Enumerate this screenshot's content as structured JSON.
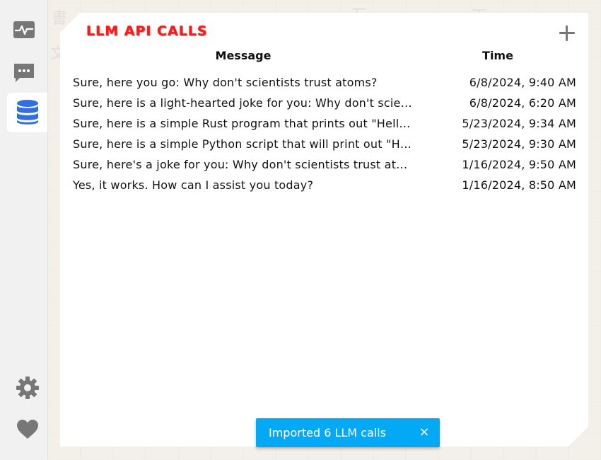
{
  "panel": {
    "title": "LLM API CALLS",
    "add_icon": "plus-icon"
  },
  "sidebar": {
    "items": [
      {
        "name": "activity",
        "icon": "pulse-icon",
        "active": false
      },
      {
        "name": "chat",
        "icon": "chat-bubble-icon",
        "active": false
      },
      {
        "name": "database",
        "icon": "database-icon",
        "active": true
      },
      {
        "name": "settings",
        "icon": "gear-icon",
        "active": false
      },
      {
        "name": "favorites",
        "icon": "heart-icon",
        "active": false
      }
    ]
  },
  "table": {
    "headers": {
      "message": "Message",
      "time": "Time"
    },
    "rows": [
      {
        "message": "Sure, here you go: Why don't scientists trust atoms?",
        "time": "6/8/2024, 9:40 AM"
      },
      {
        "message": "Sure, here is a light-hearted joke for you: Why don't scientists trust atoms?",
        "time": "6/8/2024, 6:20 AM"
      },
      {
        "message": "Sure, here is a simple Rust program that prints out \"Hello, world!\"",
        "time": "5/23/2024, 9:34 AM"
      },
      {
        "message": "Sure, here is a simple Python script that will print out \"Hello, world!\"",
        "time": "5/23/2024, 9:30 AM"
      },
      {
        "message": "Sure, here's a joke for you: Why don't scientists trust atoms?",
        "time": "1/16/2024, 9:50 AM"
      },
      {
        "message": "Yes, it works. How can I assist you today?",
        "time": "1/16/2024, 8:50 AM"
      }
    ]
  },
  "toast": {
    "text": "Imported 6 LLM calls",
    "close_label": "×"
  },
  "colors": {
    "accent": "#2f6fe4",
    "title": "#ff1a1a",
    "toast": "#03a9f4",
    "icon": "#777777"
  }
}
